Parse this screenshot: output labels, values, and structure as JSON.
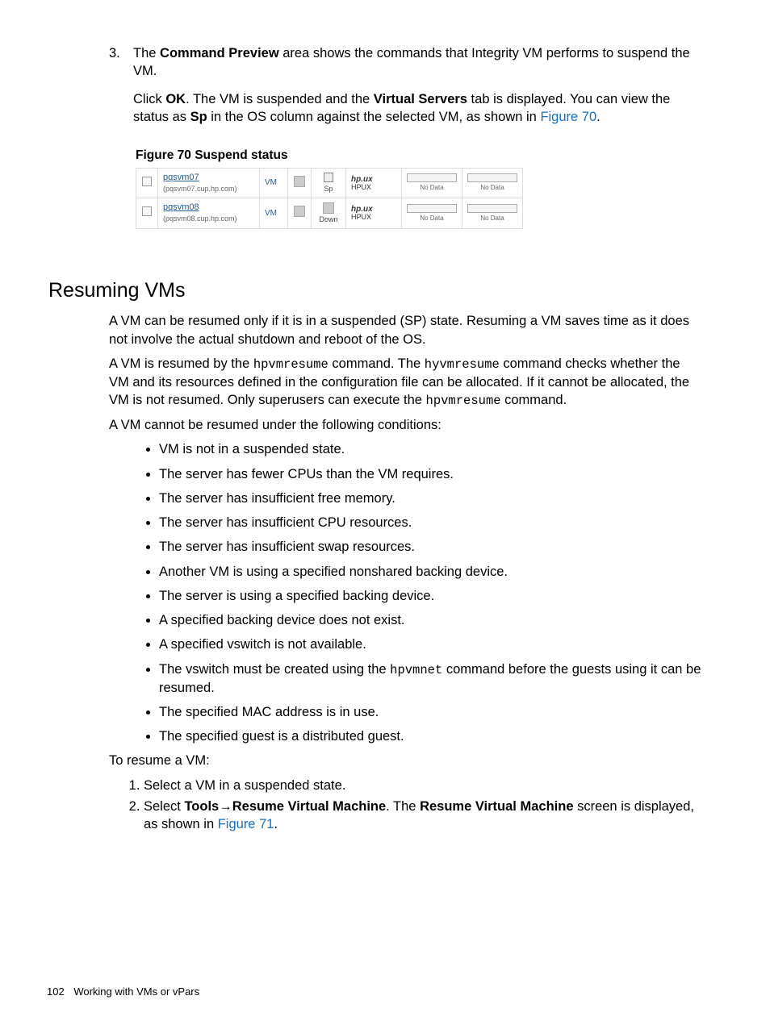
{
  "step3": {
    "num": "3.",
    "p1_a": "The ",
    "p1_bold": "Command Preview",
    "p1_b": " area shows the commands that Integrity VM performs to suspend the VM.",
    "p2_a": "Click ",
    "p2_ok": "OK",
    "p2_b": ". The VM is suspended and the ",
    "p2_vs": "Virtual Servers",
    "p2_c": " tab is displayed. You can view the status as ",
    "p2_sp": "Sp",
    "p2_d": " in the OS column against the selected VM, as shown in ",
    "p2_link": "Figure 70",
    "p2_e": "."
  },
  "fig70": {
    "caption": "Figure 70 Suspend status",
    "row1": {
      "name": "pqsvm07",
      "sub": "(pqsvm07.cup.hp.com)",
      "vm": "VM",
      "state": "Sp",
      "os_logo": "hp.ux",
      "os_sub": "HPUX",
      "nd": "No Data"
    },
    "row2": {
      "name": "pqsvm08",
      "sub": "(pqsvm08.cup.hp.com)",
      "vm": "VM",
      "state": "Down",
      "os_logo": "hp.ux",
      "os_sub": "HPUX",
      "nd": "No Data"
    }
  },
  "h2": "Resuming VMs",
  "para1": "A VM can be resumed only if it is in a suspended (SP) state. Resuming a VM saves time as it does not involve the actual shutdown and reboot of the OS.",
  "para2_a": "A VM is resumed by the ",
  "para2_code1": "hpvmresume",
  "para2_b": " command. The ",
  "para2_code2": "hyvmresume",
  "para2_c": " command checks whether the VM and its resources defined in the configuration file can be allocated. If it cannot be allocated, the VM is not resumed. Only superusers can execute the ",
  "para2_code3": "hpvmresume",
  "para2_d": " command.",
  "para3": "A VM cannot be resumed under the following conditions:",
  "cond": [
    "VM is not in a suspended state.",
    "The server has fewer CPUs than the VM requires.",
    "The server has insufficient free memory.",
    "The server has insufficient CPU resources.",
    "The server has insufficient swap resources.",
    "Another VM is using a specified nonshared backing device.",
    "The server is using a specified backing device.",
    "A specified backing device does not exist.",
    "A specified vswitch is not available."
  ],
  "cond10_a": "The vswitch must be created using the ",
  "cond10_code": "hpvmnet",
  "cond10_b": " command before the guests using it can be resumed.",
  "cond11": "The specified MAC address is in use.",
  "cond12": "The specified guest is a distributed guest.",
  "para4": "To resume a VM:",
  "step_r1": "Select a VM in a suspended state.",
  "step_r2_a": "Select ",
  "step_r2_b1": "Tools",
  "step_r2_arrow": "→",
  "step_r2_b2": "Resume Virtual Machine",
  "step_r2_c": ". The ",
  "step_r2_b3": "Resume Virtual Machine",
  "step_r2_d": " screen is displayed, as shown in ",
  "step_r2_link": "Figure 71",
  "step_r2_e": ".",
  "footer": {
    "pno": "102",
    "title": "Working with VMs or vPars"
  }
}
